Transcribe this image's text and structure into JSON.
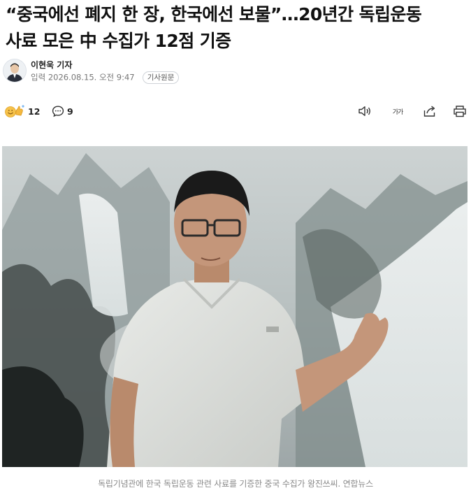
{
  "article": {
    "headline_line1": "“중국에선 폐지 한 장, 한국에선 보물”…20년간 독립운동",
    "headline_line2": "사료 모은 中 수집가 12점 기증"
  },
  "byline": {
    "author": "이현욱 기자",
    "date_label": "입력 2026.08.15. 오전 9:47",
    "original_button": "기사원문"
  },
  "engagement": {
    "reaction_count": "12",
    "comment_count": "9",
    "icons": [
      "reaction-emoji-icon",
      "comment-icon",
      "audio-icon",
      "text-size-icon",
      "share-icon",
      "print-icon"
    ],
    "text_size_glyph": "가가"
  },
  "photo": {
    "caption": "독립기념관에 한국 독립운동 관련 사료를 기증한 중국 수집가 왕진쓰씨. 연합뉴스"
  },
  "colors": {
    "headline": "#111111",
    "meta": "#777777",
    "caption": "#8a8a8a"
  }
}
